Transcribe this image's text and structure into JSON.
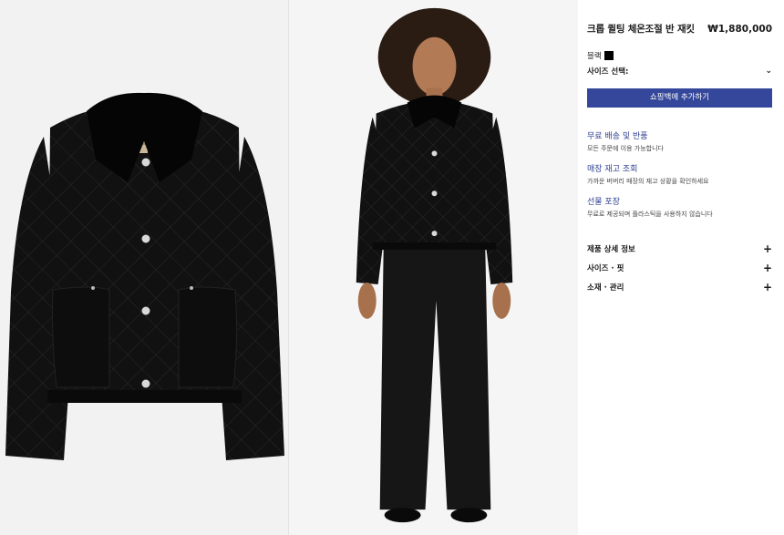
{
  "product": {
    "title": "크롭 퀼팅 체온조절 반 재킷",
    "price": "₩1,880,000",
    "color_label": "블랙",
    "swatch_color": "#000000",
    "size_label": "사이즈 선택:",
    "add_to_bag": "쇼핑백에 추가하기"
  },
  "services": [
    {
      "title": "무료 배송 및 반품",
      "desc": "모든 주문에 이용 가능합니다"
    },
    {
      "title": "매장 재고 조회",
      "desc": "가까운 버버리 매장의 재고 상황을 확인하세요"
    },
    {
      "title": "선물 포장",
      "desc": "무료로 제공되며 플라스틱을 사용하지 않습니다"
    }
  ],
  "accordion": [
    {
      "label": "제품 상세 정보"
    },
    {
      "label": "사이즈 · 핏"
    },
    {
      "label": "소재 · 관리"
    }
  ],
  "theme": {
    "accent": "#34479b",
    "link": "#2d3f8f"
  },
  "icons": {
    "size_dropdown": "chevron-down-icon",
    "expand": "plus-icon"
  }
}
